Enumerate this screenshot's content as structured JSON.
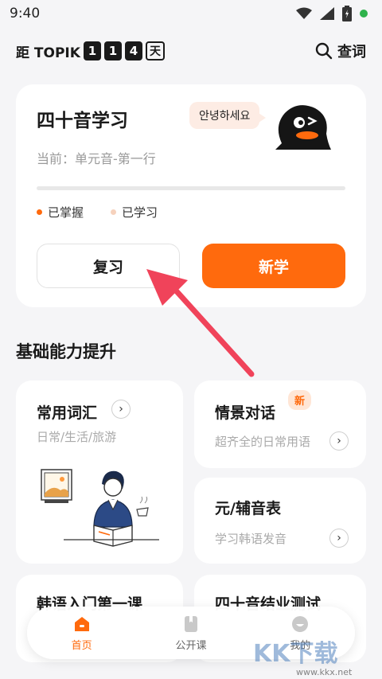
{
  "status_bar": {
    "time": "9:40"
  },
  "header": {
    "countdown_prefix": "距 TOPIK",
    "digits": [
      "1",
      "1",
      "4"
    ],
    "day_char": "天",
    "search_label": "查词"
  },
  "main_card": {
    "title": "四十音学习",
    "bubble_text": "안녕하세요",
    "subtitle": "当前：单元音-第一行",
    "progress": 0,
    "legend": [
      {
        "label": "已掌握",
        "color": "#ff6a0d"
      },
      {
        "label": "已学习",
        "color": "#f6d2bd"
      }
    ],
    "review_label": "复习",
    "new_label": "新学"
  },
  "section": {
    "title": "基础能力提升"
  },
  "cards": {
    "vocab": {
      "title": "常用词汇",
      "subtitle": "日常/生活/旅游"
    },
    "dialog": {
      "title": "情景对话",
      "badge": "新",
      "subtitle": "超齐全的日常用语"
    },
    "alphabet": {
      "title": "元/辅音表",
      "subtitle": "学习韩语发音"
    },
    "intro": {
      "title": "韩语入门第一课"
    },
    "test": {
      "title": "四十音结业测试"
    }
  },
  "tabbar": {
    "tabs": [
      {
        "label": "首页",
        "active": true
      },
      {
        "label": "公开课",
        "active": false
      },
      {
        "label": "我的",
        "active": false
      }
    ]
  },
  "watermark": {
    "text": "KK下载",
    "url": "www.kkx.net"
  },
  "colors": {
    "accent": "#ff6a0d",
    "arrow": "#f0435a"
  }
}
